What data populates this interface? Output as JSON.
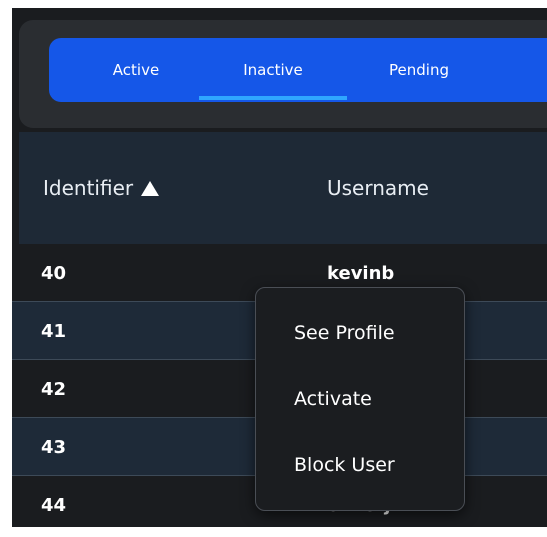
{
  "tabs": [
    {
      "label": "Active"
    },
    {
      "label": "Inactive"
    },
    {
      "label": "Pending"
    }
  ],
  "selected_tab": "Inactive",
  "table": {
    "columns": {
      "identifier": "Identifier",
      "username": "Username"
    },
    "sort": {
      "column": "Identifier",
      "direction": "ascending"
    },
    "rows": [
      {
        "id": "40",
        "username": "kevinb"
      },
      {
        "id": "41",
        "username": ""
      },
      {
        "id": "42",
        "username": ""
      },
      {
        "id": "43",
        "username": ""
      },
      {
        "id": "44",
        "username": "oliverj"
      }
    ]
  },
  "context_menu": {
    "items": [
      {
        "label": "See Profile"
      },
      {
        "label": "Activate"
      },
      {
        "label": "Block User"
      }
    ]
  },
  "colors": {
    "background": "#1a1c1f",
    "tab_bar": "#1557e8",
    "tab_indicator": "#2fa6ff",
    "header_row": "#1e2936",
    "odd_row": "#1e2a38"
  }
}
